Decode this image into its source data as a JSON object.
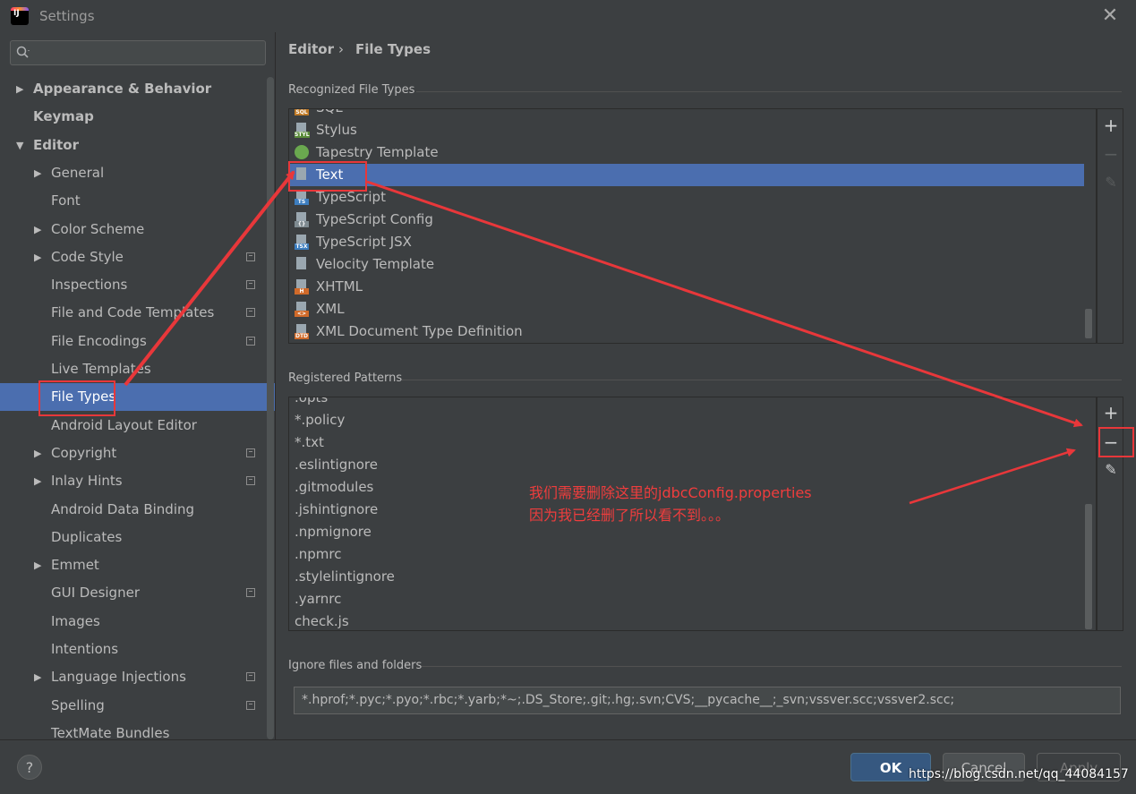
{
  "window": {
    "title": "Settings",
    "close": "✕"
  },
  "search": {
    "placeholder": ""
  },
  "sidebar": {
    "items": [
      {
        "label": "Appearance & Behavior",
        "level": 0,
        "arrow": "right",
        "bold": true
      },
      {
        "label": "Keymap",
        "level": 0,
        "arrow": "",
        "bold": true
      },
      {
        "label": "Editor",
        "level": 0,
        "arrow": "down",
        "bold": true
      },
      {
        "label": "General",
        "level": 1,
        "arrow": "right"
      },
      {
        "label": "Font",
        "level": 1,
        "arrow": ""
      },
      {
        "label": "Color Scheme",
        "level": 1,
        "arrow": "right"
      },
      {
        "label": "Code Style",
        "level": 1,
        "arrow": "right",
        "project": true
      },
      {
        "label": "Inspections",
        "level": 1,
        "arrow": "",
        "project": true
      },
      {
        "label": "File and Code Templates",
        "level": 1,
        "arrow": "",
        "project": true
      },
      {
        "label": "File Encodings",
        "level": 1,
        "arrow": "",
        "project": true
      },
      {
        "label": "Live Templates",
        "level": 1,
        "arrow": ""
      },
      {
        "label": "File Types",
        "level": 1,
        "arrow": "",
        "selected": true
      },
      {
        "label": "Android Layout Editor",
        "level": 1,
        "arrow": ""
      },
      {
        "label": "Copyright",
        "level": 1,
        "arrow": "right",
        "project": true
      },
      {
        "label": "Inlay Hints",
        "level": 1,
        "arrow": "right",
        "project": true
      },
      {
        "label": "Android Data Binding",
        "level": 1,
        "arrow": ""
      },
      {
        "label": "Duplicates",
        "level": 1,
        "arrow": ""
      },
      {
        "label": "Emmet",
        "level": 1,
        "arrow": "right"
      },
      {
        "label": "GUI Designer",
        "level": 1,
        "arrow": "",
        "project": true
      },
      {
        "label": "Images",
        "level": 1,
        "arrow": ""
      },
      {
        "label": "Intentions",
        "level": 1,
        "arrow": ""
      },
      {
        "label": "Language Injections",
        "level": 1,
        "arrow": "right",
        "project": true
      },
      {
        "label": "Spelling",
        "level": 1,
        "arrow": "",
        "project": true
      },
      {
        "label": "TextMate Bundles",
        "level": 1,
        "arrow": ""
      }
    ]
  },
  "breadcrumb": {
    "parent": "Editor",
    "separator": "›",
    "current": "File Types"
  },
  "recognized": {
    "label": "Recognized File Types",
    "items": [
      {
        "label": "SQL",
        "tag": "SQL",
        "color": "#c07a26"
      },
      {
        "label": "Stylus",
        "tag": "STYL",
        "color": "#5a8c3a"
      },
      {
        "label": "Tapestry Template",
        "tag": "",
        "color": "#6aa84f",
        "round": true
      },
      {
        "label": "Text",
        "tag": "",
        "color": "#9aa7b0",
        "selected": true
      },
      {
        "label": "TypeScript",
        "tag": "TS",
        "color": "#3d7ebf"
      },
      {
        "label": "TypeScript Config",
        "tag": "{}",
        "color": "#7f8b91"
      },
      {
        "label": "TypeScript JSX",
        "tag": "TSX",
        "color": "#3d7ebf"
      },
      {
        "label": "Velocity Template",
        "tag": "",
        "color": "#9aa7b0"
      },
      {
        "label": "XHTML",
        "tag": "H",
        "color": "#d06a2a"
      },
      {
        "label": "XML",
        "tag": "<>",
        "color": "#d06a2a"
      },
      {
        "label": "XML Document Type Definition",
        "tag": "DTD",
        "color": "#d06a2a"
      }
    ]
  },
  "patterns": {
    "label": "Registered Patterns",
    "items": [
      ".opts",
      "*.policy",
      "*.txt",
      ".eslintignore",
      ".gitmodules",
      ".jshintignore",
      ".npmignore",
      ".npmrc",
      ".stylelintignore",
      ".yarnrc",
      "check.js"
    ]
  },
  "toolbar": {
    "add": "+",
    "remove": "−",
    "edit": "✎"
  },
  "ignore": {
    "label": "Ignore files and folders",
    "value": "*.hprof;*.pyc;*.pyo;*.rbc;*.yarb;*~;.DS_Store;.git;.hg;.svn;CVS;__pycache__;_svn;vssver.scc;vssver2.scc;"
  },
  "buttons": {
    "help": "?",
    "ok": "OK",
    "cancel": "Cancel",
    "apply": "Apply"
  },
  "annotation": {
    "line1": "我们需要删除这里的jdbcConfig.properties",
    "line2": "因为我已经删了所以看不到。。。",
    "color": "#e8373a"
  },
  "watermark": "https://blog.csdn.net/qq_44084157"
}
